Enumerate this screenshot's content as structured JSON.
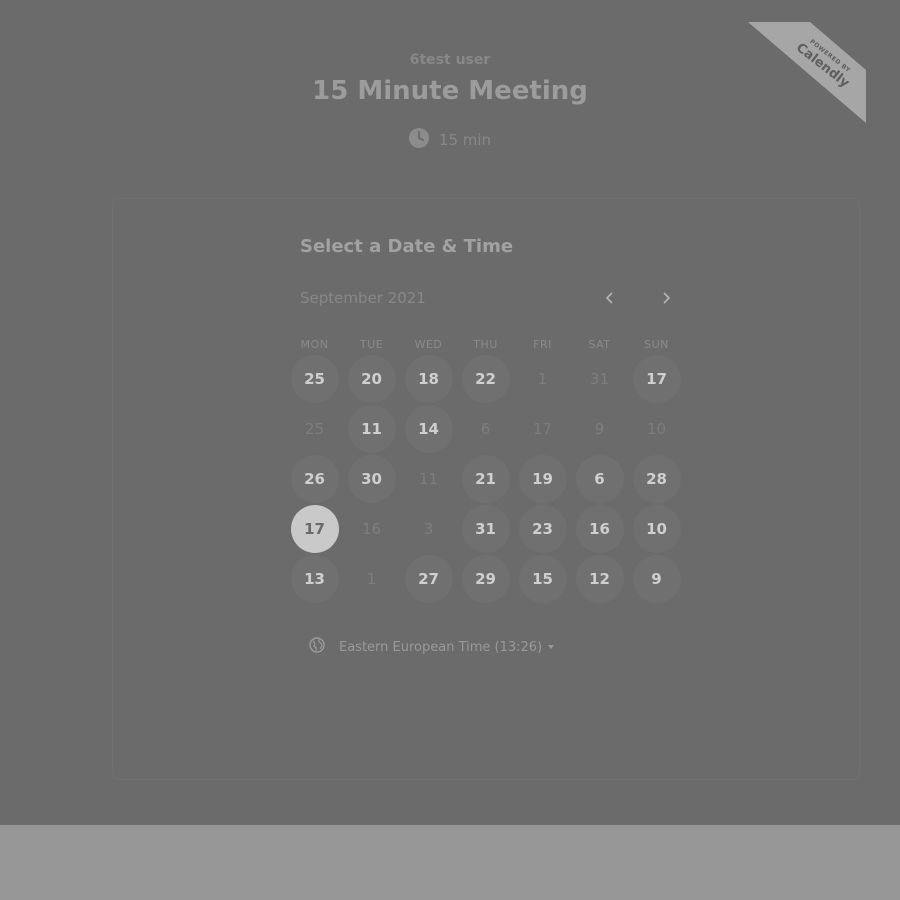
{
  "event": {
    "owner": "6test user",
    "title": "15 Minute Meeting",
    "duration": "15 min"
  },
  "branding": {
    "powered_by": "POWERED BY",
    "brand": "Calendly"
  },
  "scheduler": {
    "heading": "Select a Date & Time",
    "month_label": "September 2021",
    "weekdays": [
      "MON",
      "TUE",
      "WED",
      "THU",
      "FRI",
      "SAT",
      "SUN"
    ],
    "days": [
      {
        "label": "25",
        "state": "available"
      },
      {
        "label": "20",
        "state": "available"
      },
      {
        "label": "18",
        "state": "available"
      },
      {
        "label": "22",
        "state": "available"
      },
      {
        "label": "1",
        "state": "unavailable"
      },
      {
        "label": "31",
        "state": "unavailable"
      },
      {
        "label": "17",
        "state": "available"
      },
      {
        "label": "25",
        "state": "unavailable"
      },
      {
        "label": "11",
        "state": "available"
      },
      {
        "label": "14",
        "state": "available"
      },
      {
        "label": "6",
        "state": "unavailable"
      },
      {
        "label": "17",
        "state": "unavailable"
      },
      {
        "label": "9",
        "state": "unavailable"
      },
      {
        "label": "10",
        "state": "unavailable"
      },
      {
        "label": "26",
        "state": "available"
      },
      {
        "label": "30",
        "state": "available"
      },
      {
        "label": "11",
        "state": "unavailable"
      },
      {
        "label": "21",
        "state": "available"
      },
      {
        "label": "19",
        "state": "available"
      },
      {
        "label": "6",
        "state": "available"
      },
      {
        "label": "28",
        "state": "available"
      },
      {
        "label": "17",
        "state": "selected"
      },
      {
        "label": "16",
        "state": "unavailable"
      },
      {
        "label": "3",
        "state": "unavailable"
      },
      {
        "label": "31",
        "state": "available"
      },
      {
        "label": "23",
        "state": "available"
      },
      {
        "label": "16",
        "state": "available"
      },
      {
        "label": "10",
        "state": "available"
      },
      {
        "label": "13",
        "state": "available"
      },
      {
        "label": "1",
        "state": "unavailable"
      },
      {
        "label": "27",
        "state": "available"
      },
      {
        "label": "29",
        "state": "available"
      },
      {
        "label": "15",
        "state": "available"
      },
      {
        "label": "12",
        "state": "available"
      },
      {
        "label": "9",
        "state": "available"
      }
    ],
    "timezone": "Eastern European Time (13:26)"
  },
  "icons": {
    "clock": "clock-icon",
    "prev": "chevron-left-icon",
    "next": "chevron-right-icon",
    "globe": "globe-icon",
    "timezone_dropdown": "caret-down-icon"
  },
  "colors": {
    "overlay_background": "#6b6b6b",
    "footer_background": "#969696",
    "available_day_bg": "#707070",
    "selected_day_bg": "#c9c9c9"
  }
}
